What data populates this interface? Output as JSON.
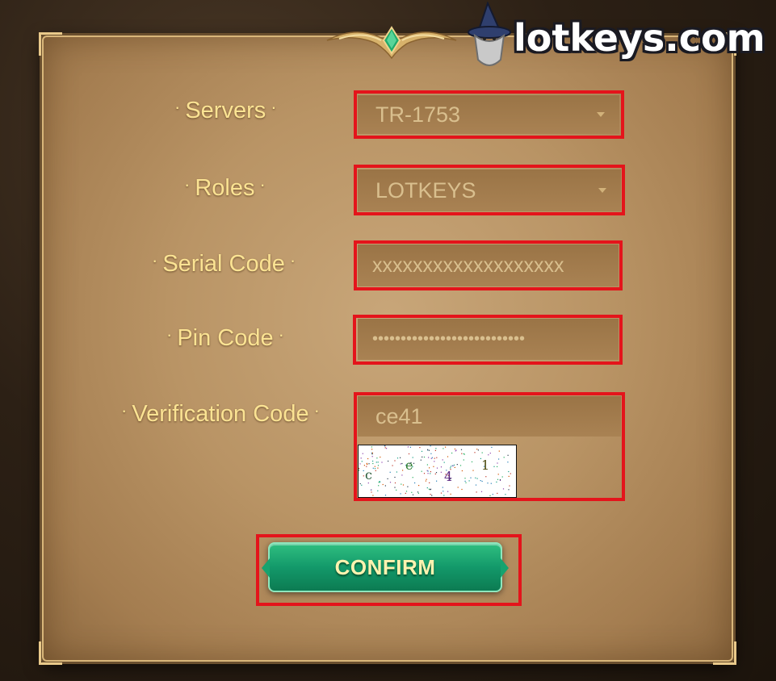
{
  "watermark": {
    "text": "lotkeys.com"
  },
  "form": {
    "servers": {
      "label": "Servers",
      "value": "TR-1753"
    },
    "roles": {
      "label": "Roles",
      "value": "LOTKEYS"
    },
    "serial": {
      "label": "Serial Code",
      "value": "xxxxxxxxxxxxxxxxxxx"
    },
    "pin": {
      "label": "Pin Code",
      "value": "•••••••••••••••••••••••••••"
    },
    "verification": {
      "label": "Verification Code",
      "value": "ce41",
      "captcha_chars": [
        "c",
        "e",
        "4",
        "1"
      ]
    },
    "separator": "·"
  },
  "confirm_label": "CONFIRM",
  "colors": {
    "label": "#fbe393",
    "highlight": "#e4141b",
    "button": "#13996a",
    "button_text": "#fff3b0"
  }
}
